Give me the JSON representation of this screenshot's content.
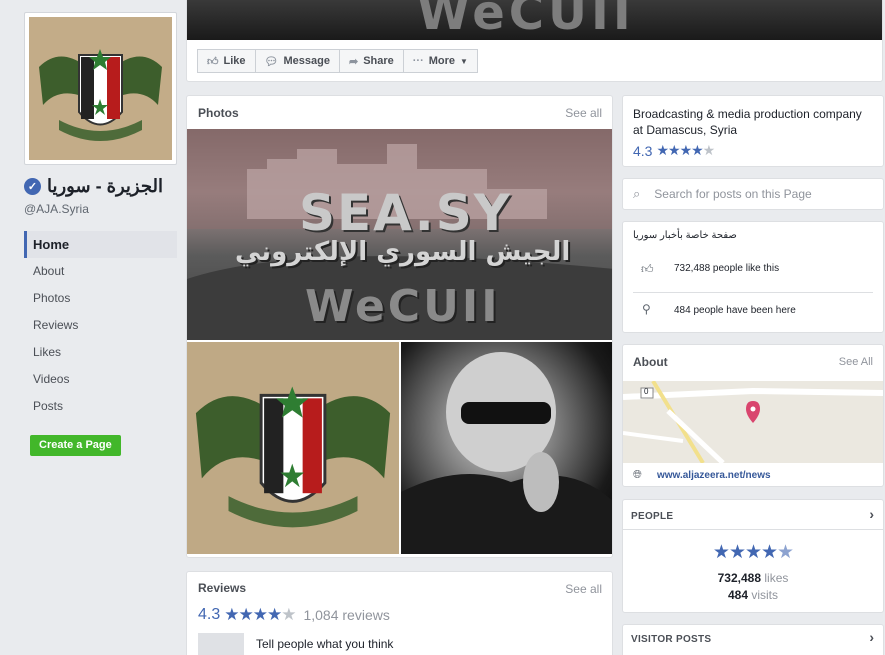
{
  "page": {
    "name": "الجزيرة - سوريا",
    "handle": "@AJA.Syria"
  },
  "nav": {
    "items": [
      "Home",
      "About",
      "Photos",
      "Reviews",
      "Likes",
      "Videos",
      "Posts"
    ],
    "active": "Home",
    "create_page_label": "Create a Page"
  },
  "cover": {
    "overlay_text": "WeCUII"
  },
  "actions": {
    "like": "Like",
    "message": "Message",
    "share": "Share",
    "more": "More"
  },
  "photos": {
    "title": "Photos",
    "see_all": "See all",
    "main_text_1": "SEA.SY",
    "main_text_2": "الجيش السوري الإلكتروني",
    "main_text_3": "WeCUII"
  },
  "reviews": {
    "title": "Reviews",
    "see_all": "See all",
    "rating": "4.3",
    "count": "1,084 reviews",
    "prompt": "Tell people what you think"
  },
  "info": {
    "description": "Broadcasting & media production company at Damascus, Syria",
    "rating": "4.3"
  },
  "search": {
    "placeholder": "Search for posts on this Page"
  },
  "likes_box": {
    "subtitle": "صفحة خاصة بأخبار سوريا",
    "likes_text": "732,488 people like this",
    "visits_text": "484 people have been here"
  },
  "about": {
    "title": "About",
    "see_all": "See All",
    "map_label": "0",
    "website": "www.aljazeera.net/news"
  },
  "people": {
    "title": "PEOPLE",
    "likes_value": "732,488",
    "likes_unit": "likes",
    "visits_value": "484",
    "visits_unit": "visits"
  },
  "visitor_posts": {
    "title": "VISITOR POSTS"
  },
  "colors": {
    "brand_blue": "#4267b2",
    "green_button": "#42b72a",
    "background": "#e9ebee"
  },
  "icons": [
    "verified-badge-icon",
    "thumbs-up-icon",
    "message-icon",
    "share-icon",
    "more-dots-icon",
    "caret-down-icon",
    "search-icon",
    "location-pin-icon",
    "globe-icon",
    "chevron-right-icon",
    "star-icon"
  ]
}
